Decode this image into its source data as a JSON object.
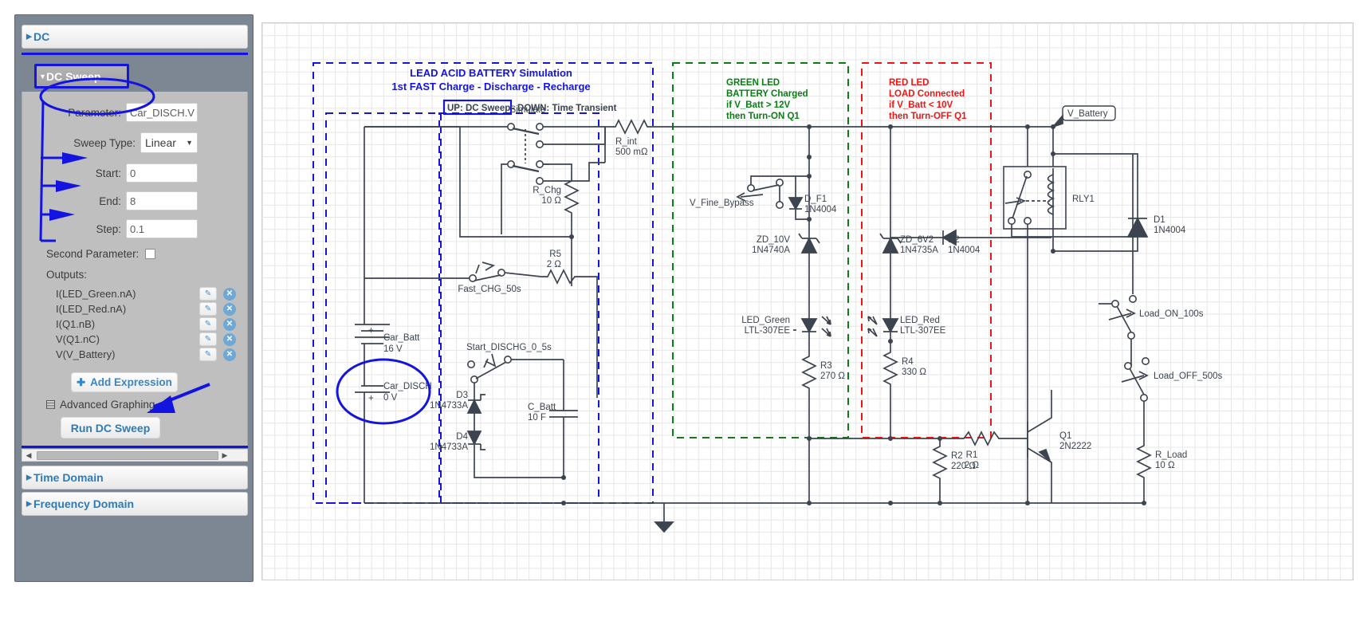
{
  "sidebar": {
    "sections": [
      {
        "label": "DC",
        "expanded": false
      },
      {
        "label": "DC Sweep",
        "expanded": true
      },
      {
        "label": "Time Domain",
        "expanded": false
      },
      {
        "label": "Frequency Domain",
        "expanded": false
      }
    ],
    "dc_sweep": {
      "parameter_label": "Parameter:",
      "parameter_value": "Car_DISCH.V",
      "sweep_type_label": "Sweep Type:",
      "sweep_type_value": "Linear",
      "start_label": "Start:",
      "start_value": "0",
      "end_label": "End:",
      "end_value": "8",
      "step_label": "Step:",
      "step_value": "0.1",
      "second_parameter_label": "Second Parameter:",
      "second_parameter_checked": false,
      "outputs_label": "Outputs:",
      "outputs": [
        "I(LED_Green.nA)",
        "I(LED_Red.nA)",
        "I(Q1.nB)",
        "V(Q1.nC)",
        "V(V_Battery)"
      ],
      "edit_icon": "pencil-icon",
      "delete_icon": "delete-circle-icon",
      "add_expression_label": "Add Expression",
      "advanced_graphing_label": "Advanced Graphing...",
      "run_label": "Run DC Sweep"
    },
    "scrollbar": {
      "left_arrow": "◀",
      "right_arrow": "▶"
    }
  },
  "annotation_color": "#1414e0",
  "schematic": {
    "title_line1": "LEAD ACID BATTERY Simulation",
    "title_line2": "1st FAST Charge - Discharge - Recharge",
    "mode_note_boxed": "UP: DC Sweep",
    "mode_note_rest": "- DOWN: Time Transient",
    "green_note": [
      "GREEN LED",
      "BATTERY Charged",
      "if V_Batt > 12V",
      "then Turn-ON Q1"
    ],
    "red_note": [
      "RED LED",
      "LOAD Connected",
      "if V_Batt < 10V",
      "then Turn-OFF Q1"
    ],
    "net_label": "V_Battery",
    "components": [
      {
        "id": "simulate-switch",
        "name": "Simulate",
        "value": ""
      },
      {
        "id": "r-int",
        "name": "R_int",
        "value": "500 mΩ"
      },
      {
        "id": "r-chg",
        "name": "R_Chg",
        "value": "10 Ω"
      },
      {
        "id": "r5",
        "name": "R5",
        "value": "2 Ω"
      },
      {
        "id": "fast-chg-switch",
        "name": "Fast_CHG_50s",
        "value": ""
      },
      {
        "id": "start-dischg",
        "name": "Start_DISCHG_0_5s",
        "value": ""
      },
      {
        "id": "car-batt",
        "name": "Car_Batt",
        "value": "16 V"
      },
      {
        "id": "car-disch",
        "name": "Car_DISCH",
        "value": "0 V"
      },
      {
        "id": "d3",
        "name": "D3",
        "value": "1N4733A"
      },
      {
        "id": "d4",
        "name": "D4",
        "value": "1N4733A"
      },
      {
        "id": "c-batt",
        "name": "C_Batt",
        "value": "10 F"
      },
      {
        "id": "v-fine-bypass",
        "name": "V_Fine_Bypass",
        "value": ""
      },
      {
        "id": "d-f1",
        "name": "D_F1",
        "value": "1N4004"
      },
      {
        "id": "zd-10v",
        "name": "ZD_10V",
        "value": "1N4740A"
      },
      {
        "id": "led-green",
        "name": "LED_Green",
        "value": "LTL-307EE"
      },
      {
        "id": "r3",
        "name": "R3",
        "value": "270 Ω"
      },
      {
        "id": "zd-6v2",
        "name": "ZD_6V2",
        "value": "1N4735A"
      },
      {
        "id": "d2",
        "name": "D2",
        "value": "1N4004"
      },
      {
        "id": "led-red",
        "name": "LED_Red",
        "value": "LTL-307EE"
      },
      {
        "id": "r4",
        "name": "R4",
        "value": "330 Ω"
      },
      {
        "id": "r2",
        "name": "R2",
        "value": "220 Ω"
      },
      {
        "id": "r1",
        "name": "R1",
        "value": "2 Ω"
      },
      {
        "id": "q1",
        "name": "Q1",
        "value": "2N2222"
      },
      {
        "id": "rly1",
        "name": "RLY1",
        "value": ""
      },
      {
        "id": "d1",
        "name": "D1",
        "value": "1N4004"
      },
      {
        "id": "load-on",
        "name": "Load_ON_100s",
        "value": ""
      },
      {
        "id": "load-off",
        "name": "Load_OFF_500s",
        "value": ""
      },
      {
        "id": "r-load",
        "name": "R_Load",
        "value": "10 Ω"
      }
    ],
    "colors": {
      "wire": "#3c4450",
      "blue_box": "#1414e0",
      "green_box": "#0a7d14",
      "red_box": "#f01414",
      "title_blue": "#1414e0",
      "green_text": "#0a7d14",
      "red_text": "#f01414"
    }
  }
}
